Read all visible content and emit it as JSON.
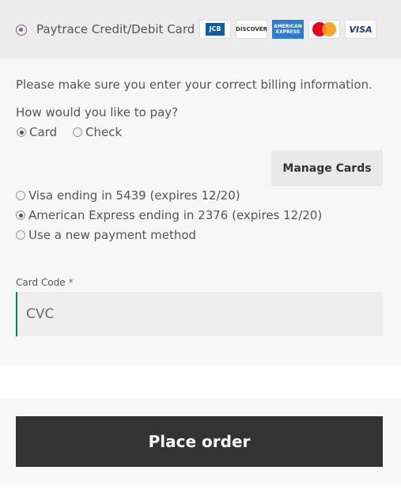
{
  "gateway": {
    "label": "Paytrace Credit/Debit Card",
    "logos": [
      "JCB",
      "DISCOVER",
      "AMERICAN EXPRESS",
      "mastercard",
      "VISA"
    ]
  },
  "billing_notice": "Please make sure you enter your correct billing information.",
  "pay_method": {
    "question": "How would you like to pay?",
    "options": [
      {
        "label": "Card",
        "selected": true
      },
      {
        "label": "Check",
        "selected": false
      }
    ]
  },
  "manage_cards_label": "Manage Cards",
  "saved_cards": [
    {
      "label": "Visa ending in 5439 (expires 12/20)",
      "selected": false
    },
    {
      "label": "American Express ending in 2376 (expires 12/20)",
      "selected": true
    },
    {
      "label": "Use a new payment method",
      "selected": false
    }
  ],
  "card_code": {
    "label": "Card Code",
    "required_mark": "*",
    "placeholder": "CVC"
  },
  "place_order_label": "Place order",
  "colors": {
    "accent": "#8f5e8a",
    "input_focus": "#0f834d",
    "button_dark": "#333333",
    "required": "#e2401c"
  }
}
